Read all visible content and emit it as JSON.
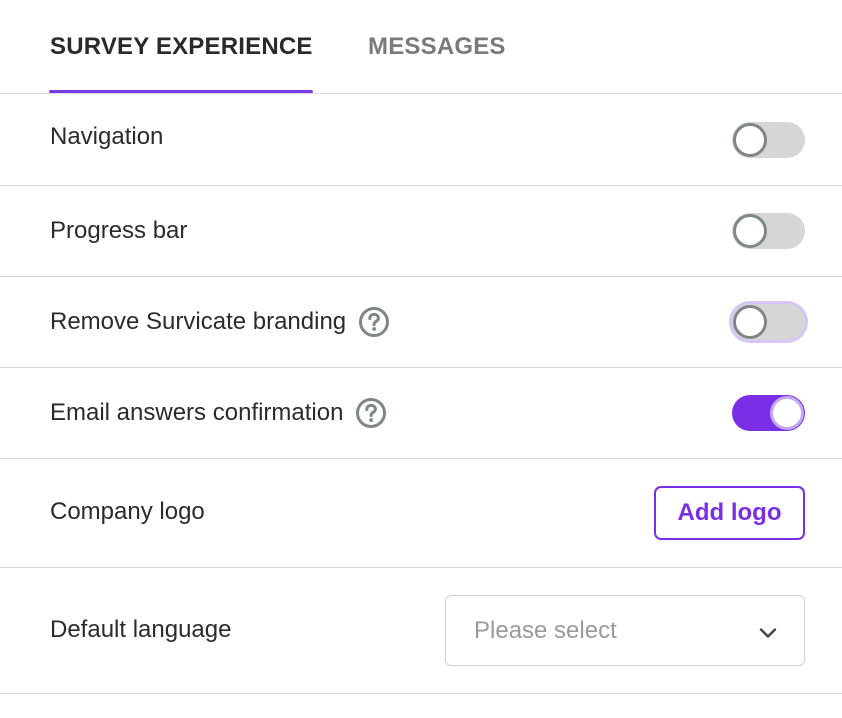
{
  "tabs": [
    {
      "label": "SURVEY EXPERIENCE",
      "active": true
    },
    {
      "label": "MESSAGES",
      "active": false
    }
  ],
  "settings": {
    "navigation": {
      "label": "Navigation",
      "enabled": false
    },
    "progress_bar": {
      "label": "Progress bar",
      "enabled": false
    },
    "remove_branding": {
      "label": "Remove Survicate branding",
      "enabled": false,
      "icon": "help-circle-icon"
    },
    "email_confirmation": {
      "label": "Email answers confirmation",
      "enabled": true,
      "icon": "help-circle-icon"
    },
    "company_logo": {
      "label": "Company logo",
      "button_label": "Add logo"
    },
    "default_language": {
      "label": "Default language",
      "placeholder": "Please select",
      "icon": "chevron-down-icon"
    }
  },
  "colors": {
    "accent": "#7a2fe6",
    "toggle_off": "#d6d6d6",
    "divider": "#d9d9d9"
  }
}
